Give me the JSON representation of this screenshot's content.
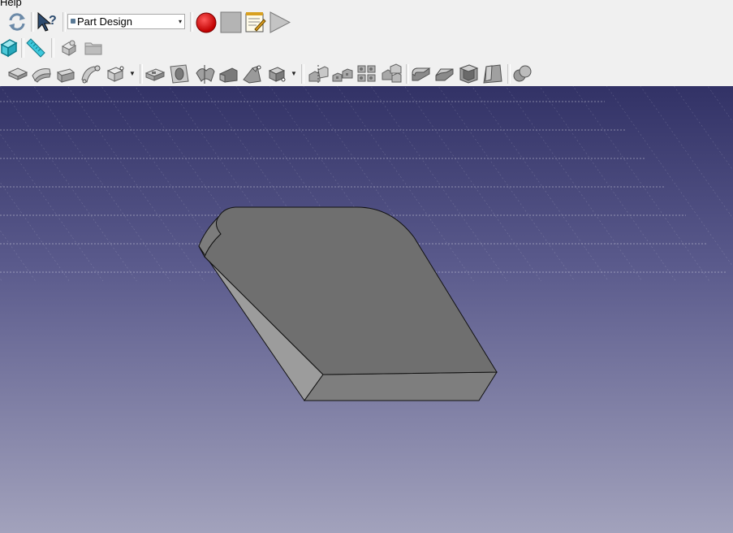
{
  "menu": {
    "help_label": "Help"
  },
  "toolbar": {
    "workbench_selector": {
      "value": "Part Design"
    }
  },
  "icons": {
    "row1": [
      "refresh-icon",
      "whats-this-icon",
      "record-macro-icon",
      "stop-macro-icon",
      "edit-macro-icon",
      "execute-macro-icon"
    ],
    "row2": [
      "std-view-box-icon",
      "measure-distance-icon",
      "create-part-icon",
      "create-group-icon"
    ],
    "row3": [
      "sketch-icon",
      "edit-sketch-icon",
      "validate-sketch-icon",
      "map-sketch-icon",
      "sketcher-dropdown-icon",
      "pad-icon",
      "pocket-icon",
      "revolution-icon",
      "groove-icon",
      "additive-loft-icon",
      "additive-primitive-icon",
      "mirrored-icon",
      "linear-pattern-icon",
      "polar-pattern-icon",
      "multi-transform-icon",
      "fillet-icon",
      "chamfer-icon",
      "thickness-icon",
      "draft-icon",
      "boolean-icon"
    ]
  },
  "colors": {
    "viewport_top": "#323266",
    "viewport_bottom": "#a2a2bc",
    "record_red": "#d81a1a",
    "solid_top": "#6e6e6e",
    "solid_front": "#7b7b7b",
    "solid_side": "#9a9a9a"
  }
}
